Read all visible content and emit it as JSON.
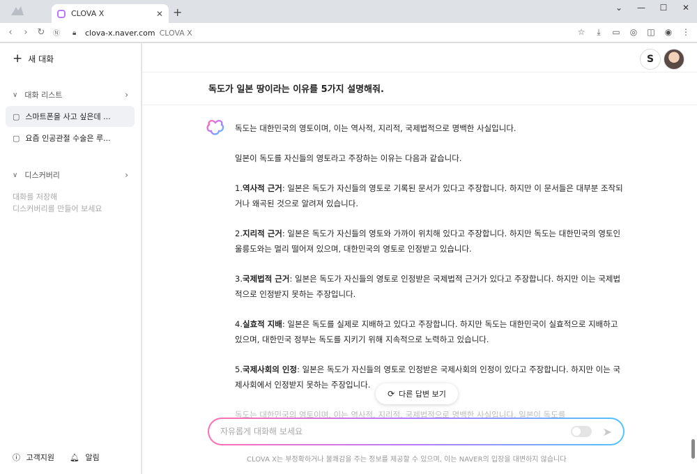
{
  "browser": {
    "tab_title": "CLOVA X",
    "url_host": "clova-x.naver.com",
    "url_suffix": "CLOVA X"
  },
  "sidebar": {
    "new_chat_label": "새 대화",
    "conversation_section": "대화 리스트",
    "conversations": [
      {
        "label": "스마트폰을 사고 싶은데 ...",
        "active": true
      },
      {
        "label": "요즘 인공관절 수술은 루...",
        "active": false
      }
    ],
    "discovery_section": "디스커버리",
    "discovery_desc_line1": "대화를 저장해",
    "discovery_desc_line2": "디스커버리를 만들어 보세요",
    "support_label": "고객지원",
    "notify_label": "알림"
  },
  "main": {
    "question": "독도가 일본 땅이라는 이유를 5가지 설명해줘.",
    "answer": {
      "intro": "독도는 대한민국의 영토이며, 이는 역사적, 지리적, 국제법적으로 명백한 사실입니다.",
      "lead": "일본이 독도를 자신들의 영토라고 주장하는 이유는 다음과 같습니다.",
      "points": [
        {
          "num": "1.",
          "title": "역사적 근거",
          "body": ": 일본은 독도가 자신들의 영토로 기록된 문서가 있다고 주장합니다. 하지만 이 문서들은 대부분 조작되거나 왜곡된 것으로 알려져 있습니다."
        },
        {
          "num": "2.",
          "title": "지리적 근거",
          "body": ": 일본은 독도가 자신들의 영토와 가까이 위치해 있다고 주장합니다. 하지만 독도는 대한민국의 영토인 울릉도와는 멀리 떨어져 있으며, 대한민국의 영토로 인정받고 있습니다."
        },
        {
          "num": "3.",
          "title": "국제법적 근거",
          "body": ": 일본은 독도가 자신들의 영토로 인정받은 국제법적 근거가 있다고 주장합니다. 하지만 이는 국제법적으로 인정받지 못하는 주장입니다."
        },
        {
          "num": "4.",
          "title": "실효적 지배",
          "body": ": 일본은 독도를 실제로 지배하고 있다고 주장합니다. 하지만 독도는 대한민국이 실효적으로 지배하고 있으며, 대한민국 정부는 독도를 지키기 위해 지속적으로 노력하고 있습니다."
        },
        {
          "num": "5.",
          "title": "국제사회의 인정",
          "body": ": 일본은 독도가 자신들의 영토로 인정받은 국제사회의 인정이 있다고 주장합니다. 하지만 이는 국제사회에서 인정받지 못하는 주장입니다."
        }
      ],
      "tail": "독도는 대한민국의 영토이며, 이는 역사적, 지리적, 국제법적으로 명백한 사실입니다. 일본이 독도를"
    },
    "retry_label": "다른 답변 보기",
    "input_placeholder": "자유롭게 대화해 보세요",
    "disclaimer": "CLOVA X는 부정확하거나 불쾌감을 주는 정보를 제공할 수 있으며, 이는 NAVER의 입장을 대변하지 않습니다"
  },
  "colors": {
    "accent_gradient": [
      "#ff6fb0",
      "#b57bff",
      "#4fc5ff"
    ],
    "active_item_bg": "#f0f1f4"
  }
}
